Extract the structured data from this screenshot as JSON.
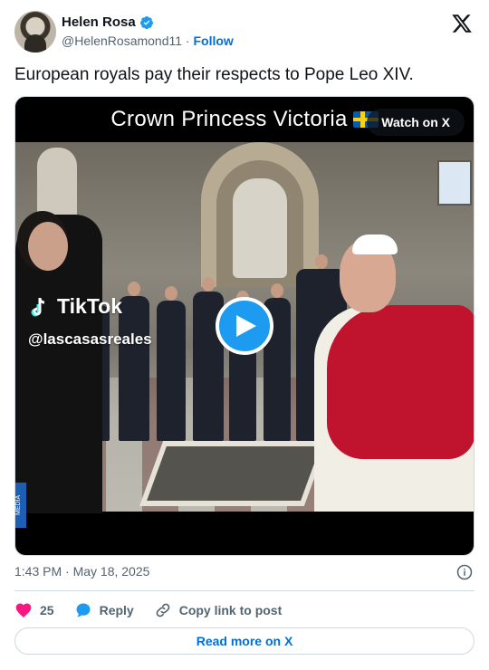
{
  "author": {
    "display_name": "Helen Rosa",
    "handle": "@HelenRosamond11",
    "separator": "·",
    "follow_label": "Follow"
  },
  "tweet": {
    "text": "European royals pay their respects to Pope Leo XIV."
  },
  "media": {
    "caption": "Crown Princess Victoria",
    "watch_label": "Watch on X",
    "watermark_brand": "TikTok",
    "watermark_user": "@lascasasreales",
    "side_label": "MEDIA"
  },
  "meta": {
    "timestamp": "1:43 PM · May 18, 2025"
  },
  "actions": {
    "like_count": "25",
    "reply_label": "Reply",
    "copy_label": "Copy link to post"
  },
  "footer": {
    "read_more_label": "Read more on X"
  },
  "colors": {
    "accent": "#1d9bf0",
    "link": "#006fd6",
    "like": "#f91880",
    "muted": "#536471"
  },
  "icons": {
    "verified": "verified-badge-icon",
    "logo": "x-logo-icon",
    "play": "play-icon",
    "info": "info-icon",
    "like": "heart-icon",
    "reply": "reply-icon",
    "copy": "link-icon"
  }
}
